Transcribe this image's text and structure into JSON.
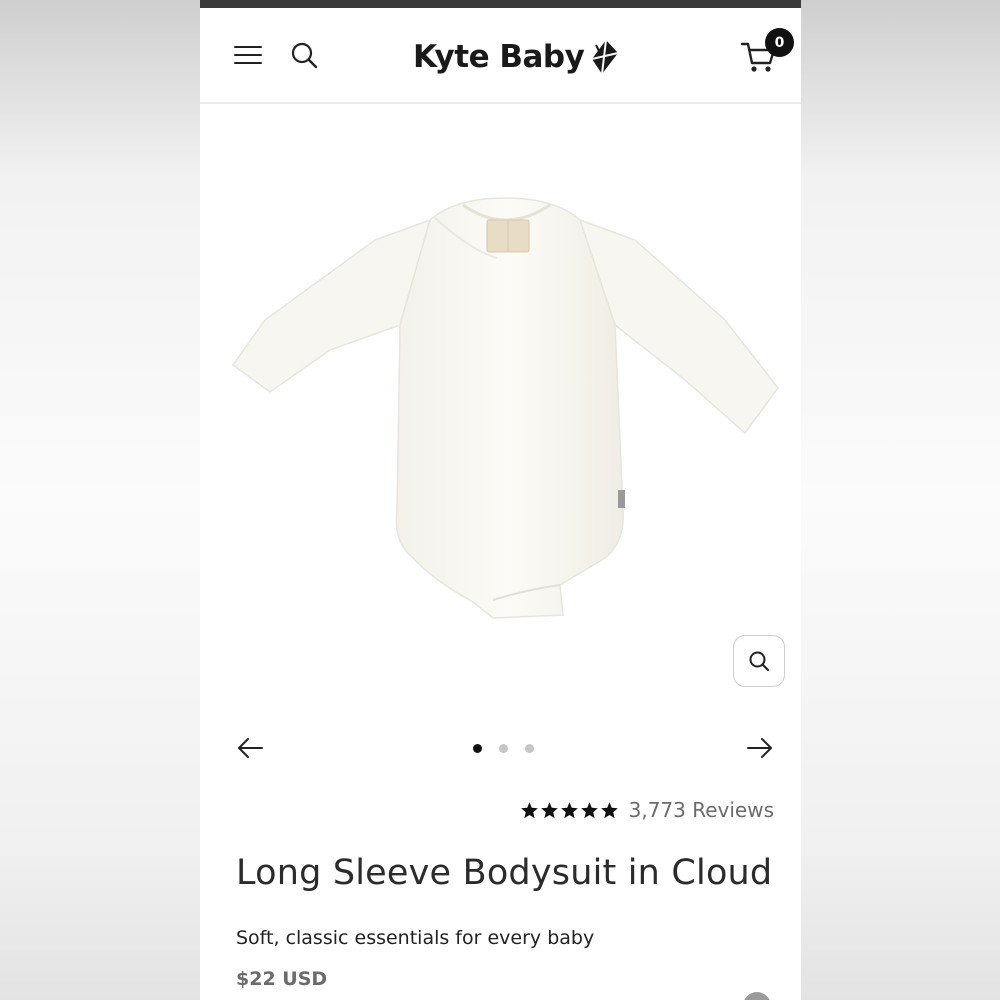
{
  "header": {
    "brand": "Kyte Baby",
    "cart_count": "0"
  },
  "gallery": {
    "slide_count": 3,
    "active_slide": 1
  },
  "product": {
    "rating_stars": 5,
    "reviews": "3,773 Reviews",
    "title": "Long Sleeve Bodysuit in Cloud",
    "subtitle": "Soft, classic essentials for every baby",
    "price": "$22 USD"
  },
  "colors": {
    "topbar": "#3a3a3c",
    "text_dark": "#2b2b2b",
    "text_muted": "#6b6b6b",
    "badge": "#111111",
    "bodysuit": "#fbfaf6"
  },
  "icons": {
    "menu": "hamburger-icon",
    "search": "search-icon",
    "cart": "cart-icon",
    "zoom": "zoom-icon",
    "prev": "arrow-left-icon",
    "next": "arrow-right-icon",
    "star": "star-icon"
  }
}
